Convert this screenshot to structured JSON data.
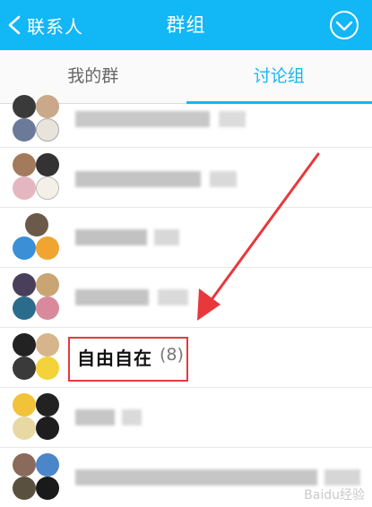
{
  "header": {
    "back_label": "联系人",
    "title": "群组"
  },
  "tabs": [
    {
      "label": "我的群",
      "active": false
    },
    {
      "label": "讨论组",
      "active": true
    }
  ],
  "discussions": [
    {
      "name": "",
      "count": "",
      "blurred": true
    },
    {
      "name": "",
      "count": "",
      "blurred": true
    },
    {
      "name": "",
      "count": "",
      "blurred": true
    },
    {
      "name": "",
      "count": "",
      "blurred": true
    },
    {
      "name": "自由自在",
      "count": "(8)",
      "blurred": false,
      "highlighted": true
    },
    {
      "name": "",
      "count": "",
      "blurred": true
    },
    {
      "name": "",
      "count": "",
      "blurred": true
    }
  ],
  "watermark": "Baidu经验",
  "colors": {
    "accent": "#12b7f5",
    "highlight_box": "#e23b3b",
    "arrow": "#e8383b"
  }
}
